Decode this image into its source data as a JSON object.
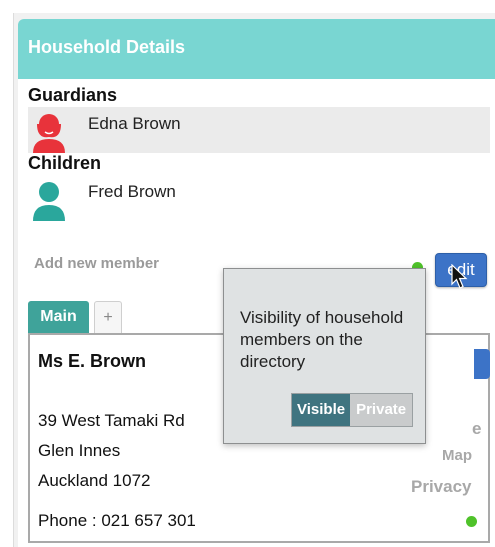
{
  "panel": {
    "title": "Household Details"
  },
  "guardians": {
    "label": "Guardians",
    "members": [
      {
        "name": "Edna Brown",
        "avatar_icon": "female-avatar-icon",
        "avatar_color": "#e8333b"
      }
    ]
  },
  "children": {
    "label": "Children",
    "members": [
      {
        "name": "Fred Brown",
        "avatar_icon": "male-avatar-icon",
        "avatar_color": "#2aa79c"
      }
    ]
  },
  "actions": {
    "add_member_label": "Add new member",
    "edit_label": "edit",
    "status_color": "#4fc22a"
  },
  "tabs": [
    {
      "label": "Main",
      "active": true
    },
    {
      "label": "+",
      "active": false
    }
  ],
  "details": {
    "name": "Ms E. Brown",
    "address_line1": "39 West Tamaki Rd",
    "address_line2": "Glen Innes",
    "address_line3": "Auckland 1072",
    "phone": "Phone : 021 657 301",
    "side_links": {
      "partial_1": "e",
      "partial_2": "Map",
      "privacy": "Privacy"
    }
  },
  "popover": {
    "text": "Visibility of household members on the directory",
    "toggle": {
      "on_label": "Visible",
      "off_label": "Private",
      "selected": "Visible"
    }
  },
  "colors": {
    "header_bg": "#79d6d2",
    "tab_active": "#3fa39a",
    "edit_button": "#3c73c7",
    "toggle_on": "#3f7480"
  }
}
